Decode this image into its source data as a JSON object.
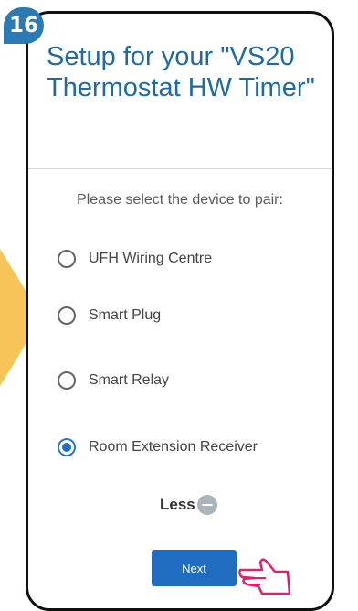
{
  "step_badge": "16",
  "header": {
    "title": "Setup for your \"VS20 Thermostat HW Timer\""
  },
  "prompt": "Please select the device to pair:",
  "options": [
    {
      "label": "UFH Wiring Centre",
      "selected": false
    },
    {
      "label": "Smart Plug",
      "selected": false
    },
    {
      "label": "Smart Relay",
      "selected": false
    },
    {
      "label": "Room Extension Receiver",
      "selected": true
    }
  ],
  "less_label": "Less",
  "next_label": "Next",
  "colors": {
    "accent": "#1f6cc1",
    "title": "#1e6aa6",
    "arrow": "#f7c45a",
    "hand": "#e0206a",
    "badge": "#2a7ab4"
  }
}
